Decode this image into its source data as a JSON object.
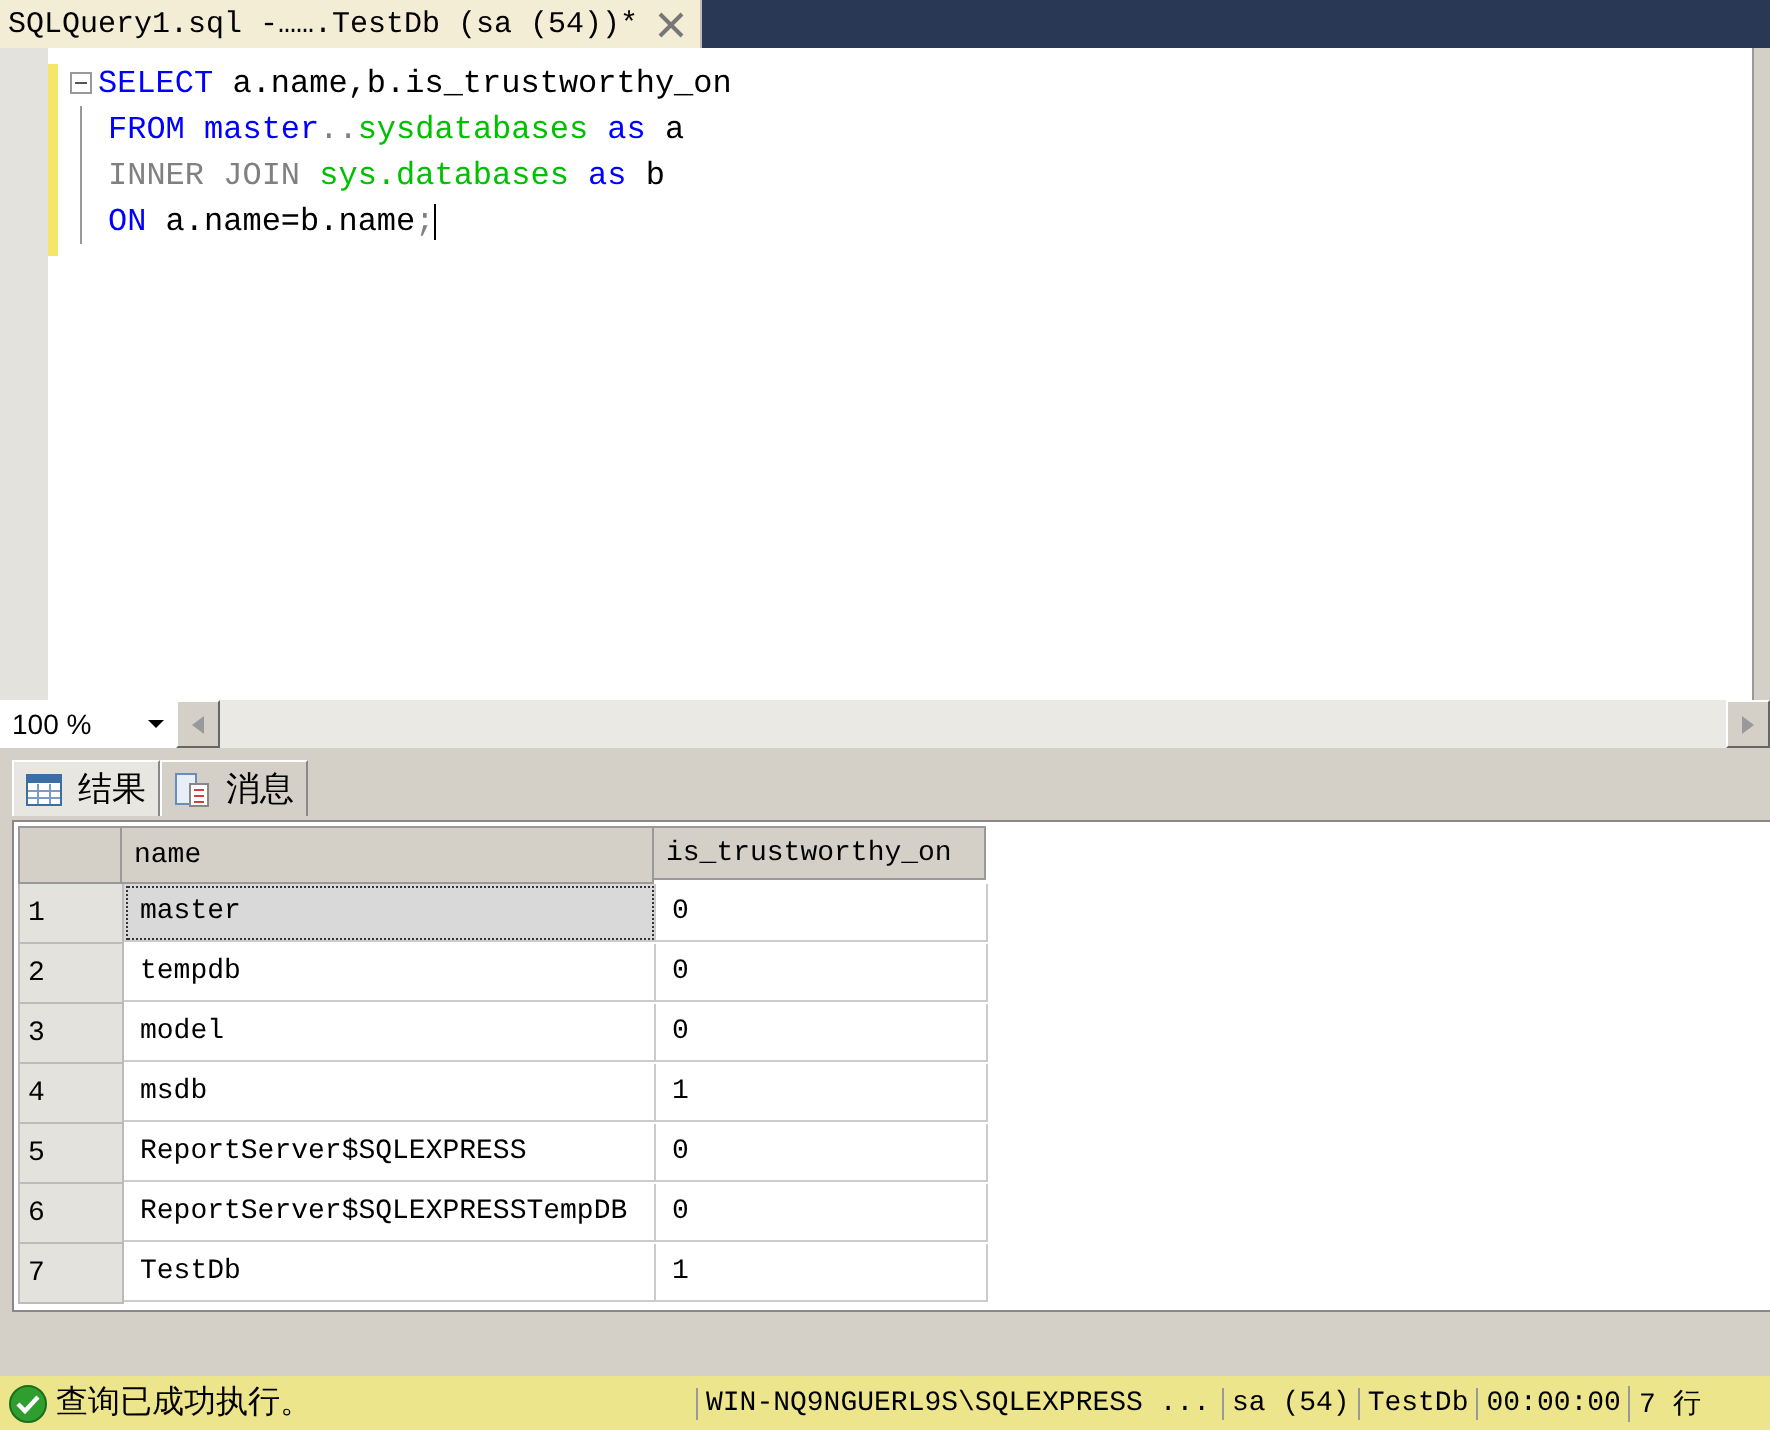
{
  "document_tab": {
    "title": "SQLQuery1.sql -…….TestDb (sa (54))*"
  },
  "editor": {
    "lines": [
      {
        "tokens": [
          {
            "text": "SELECT",
            "kind": "keyword"
          },
          {
            "text": " a.name,b.is_trustworthy_on",
            "kind": "plain"
          }
        ]
      },
      {
        "tokens": [
          {
            "text": "FROM master",
            "kind": "keyword"
          },
          {
            "text": "..",
            "kind": "operator"
          },
          {
            "text": "sysdatabases",
            "kind": "system"
          },
          {
            "text": " as",
            "kind": "keyword"
          },
          {
            "text": " a",
            "kind": "plain"
          }
        ]
      },
      {
        "tokens": [
          {
            "text": "INNER JOIN",
            "kind": "operator"
          },
          {
            "text": " sys.databases",
            "kind": "system"
          },
          {
            "text": " as",
            "kind": "keyword"
          },
          {
            "text": " b",
            "kind": "plain"
          }
        ]
      },
      {
        "tokens": [
          {
            "text": "ON",
            "kind": "keyword"
          },
          {
            "text": " a.name=b.name",
            "kind": "plain"
          },
          {
            "text": ";",
            "kind": "operator"
          }
        ]
      }
    ]
  },
  "zoom": {
    "value": "100 %"
  },
  "result_tabs": [
    {
      "label": "结果",
      "kind": "grid",
      "selected": true
    },
    {
      "label": "消息",
      "kind": "messages",
      "selected": false
    }
  ],
  "grid": {
    "columns": [
      "name",
      "is_trustworthy_on"
    ],
    "rows": [
      {
        "number": "1",
        "cells": [
          "master",
          "0"
        ],
        "selected": true
      },
      {
        "number": "2",
        "cells": [
          "tempdb",
          "0"
        ],
        "selected": false
      },
      {
        "number": "3",
        "cells": [
          "model",
          "0"
        ],
        "selected": false
      },
      {
        "number": "4",
        "cells": [
          "msdb",
          "1"
        ],
        "selected": false
      },
      {
        "number": "5",
        "cells": [
          "ReportServer$SQLEXPRESS",
          "0"
        ],
        "selected": false
      },
      {
        "number": "6",
        "cells": [
          "ReportServer$SQLEXPRESSTempDB",
          "0"
        ],
        "selected": false
      },
      {
        "number": "7",
        "cells": [
          "TestDb",
          "1"
        ],
        "selected": false
      }
    ]
  },
  "status_bar": {
    "message": "查询已成功执行。",
    "server": "WIN-NQ9NGUERL9S\\SQLEXPRESS ...",
    "user": "sa (54)",
    "database": "TestDb",
    "elapsed": "00:00:00",
    "rows": "7 行"
  }
}
